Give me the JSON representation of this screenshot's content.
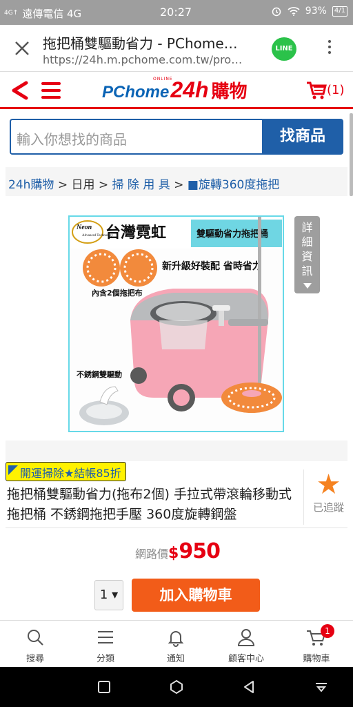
{
  "status_bar": {
    "signal": "4G↑",
    "carrier": "遠傳電信 4G",
    "time": "20:27",
    "battery": "93%",
    "battery_icon_text": "4/1"
  },
  "browser": {
    "title": "拖把桶雙驅動省力 - PChome…",
    "url": "https://24h.m.pchome.com.tw/pro…",
    "line_label": "LINE"
  },
  "header": {
    "logo_online": "ONLINE",
    "logo_pchome": "PChome",
    "logo_24h": "24h",
    "logo_gouwu": "購物",
    "cart_count": "(1)"
  },
  "search": {
    "placeholder": "輸入你想找的商品",
    "button": "找商品"
  },
  "breadcrumb": {
    "items": [
      "24h購物",
      ">",
      "日用",
      ">",
      "掃 除 用 具",
      ">",
      "■旋轉360度拖把"
    ]
  },
  "product_image": {
    "brand_en": "Neon",
    "brand_sub": "Advanced Technology",
    "brand_zh": "台灣霓虹",
    "badge": "雙驅動省力拖把桶",
    "slogan": "新升級好裝配 省時省力",
    "cloth_note": "內含2個拖把布",
    "steel_note": "不銹鋼雙驅動"
  },
  "detail_tab": {
    "label": "詳細資訊"
  },
  "product": {
    "promo": "開運掃除★結帳85折",
    "title": "拖把桶雙驅動省力(拖布2個) 手拉式帶滾輪移動式拖把桶 不銹鋼拖把手壓 360度旋轉鋼盤",
    "follow_label": "已追蹤",
    "price_label": "網路價",
    "price_currency": "$",
    "price_value": "950",
    "qty": "1 ▾",
    "add_to_cart": "加入購物車"
  },
  "bottom_nav": {
    "items": [
      {
        "label": "搜尋",
        "icon": "search-icon"
      },
      {
        "label": "分類",
        "icon": "menu-icon"
      },
      {
        "label": "通知",
        "icon": "bell-icon"
      },
      {
        "label": "顧客中心",
        "icon": "user-icon"
      },
      {
        "label": "購物車",
        "icon": "cart-icon"
      }
    ],
    "cart_badge": "1"
  },
  "colors": {
    "brand_red": "#e60012",
    "brand_blue": "#1f5fa8",
    "cta_orange": "#f25c19",
    "promo_yellow": "#fff200"
  }
}
